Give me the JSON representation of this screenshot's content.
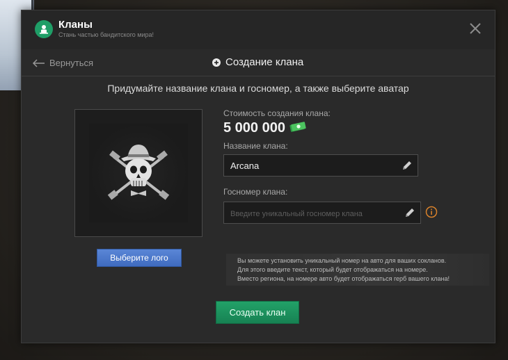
{
  "header": {
    "title": "Кланы",
    "subtitle": "Стань частью бандитского мира!"
  },
  "toolbar": {
    "back_label": "Вернуться",
    "create_title": "Создание клана"
  },
  "instruction": "Придумайте название клана и госномер, а также выберите аватар",
  "avatar": {
    "select_logo_label": "Выберите лого"
  },
  "cost": {
    "label": "Стоимость создания клана:",
    "value": "5 000 000"
  },
  "clan_name": {
    "label": "Название клана:",
    "value": "Arcana"
  },
  "plate": {
    "label": "Госномер клана:",
    "placeholder": "Введите уникальный госномер клана",
    "value": ""
  },
  "hint": {
    "lines": [
      "Вы можете установить уникальный номер на авто для ваших сокланов.",
      "Для этого введите текст, который будет отображаться на номере.",
      "Вместо региона, на номере авто будет отображаться герб вашего клана!"
    ]
  },
  "actions": {
    "create_label": "Создать клан"
  },
  "colors": {
    "accent_green": "#1f9e67",
    "logo_button_blue": "#4a77c8",
    "info_orange": "#d9822b"
  }
}
